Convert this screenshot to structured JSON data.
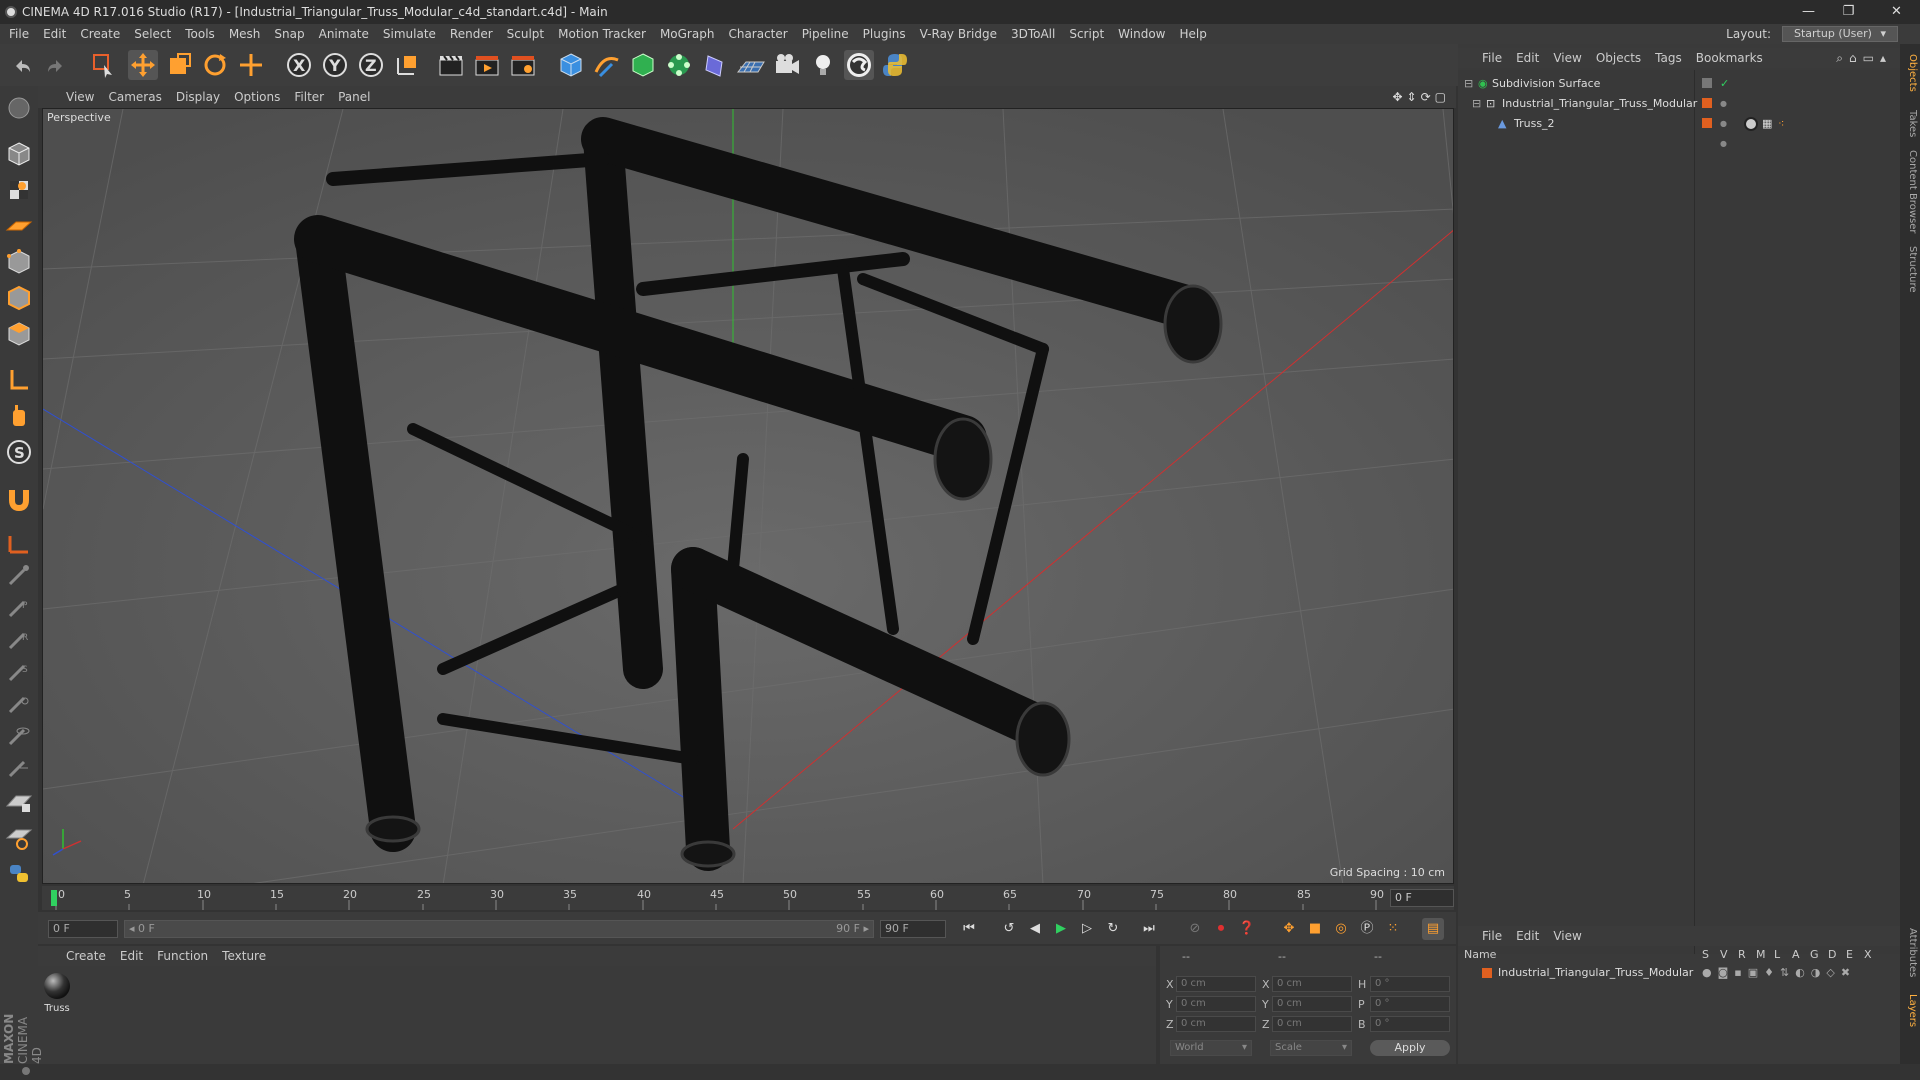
{
  "window": {
    "title": "CINEMA 4D R17.016 Studio (R17) - [Industrial_Triangular_Truss_Modular_c4d_standart.c4d] - Main",
    "minimize": "—",
    "maximize": "❐",
    "close": "✕"
  },
  "menu": [
    "File",
    "Edit",
    "Create",
    "Select",
    "Tools",
    "Mesh",
    "Snap",
    "Animate",
    "Simulate",
    "Render",
    "Sculpt",
    "Motion Tracker",
    "MoGraph",
    "Character",
    "Pipeline",
    "Plugins",
    "V-Ray Bridge",
    "3DToAll",
    "Script",
    "Window",
    "Help"
  ],
  "layout": {
    "label": "Layout:",
    "value": "Startup (User)"
  },
  "viewport": {
    "menu": [
      "View",
      "Cameras",
      "Display",
      "Options",
      "Filter",
      "Panel"
    ],
    "label": "Perspective",
    "grid_spacing": "Grid Spacing : 10 cm"
  },
  "timeline": {
    "ticks": [
      "0",
      "5",
      "10",
      "15",
      "20",
      "25",
      "30",
      "35",
      "40",
      "45",
      "50",
      "55",
      "60",
      "65",
      "70",
      "75",
      "80",
      "85",
      "90"
    ],
    "current": "0 F"
  },
  "transport": {
    "start_field": "0 F",
    "range_start": "◂ 0 F",
    "range_end": "90 F ▸",
    "end_field": "90 F"
  },
  "materials": {
    "menu": [
      "Create",
      "Edit",
      "Function",
      "Texture"
    ],
    "items": [
      {
        "name": "Truss"
      }
    ]
  },
  "attributes": {
    "header_a": "--",
    "header_b": "--",
    "header_c": "--",
    "rows": [
      {
        "a_label": "X",
        "a_val": "0 cm",
        "b_label": "X",
        "b_val": "0 cm",
        "c_label": "H",
        "c_val": "0 °"
      },
      {
        "a_label": "Y",
        "a_val": "0 cm",
        "b_label": "Y",
        "b_val": "0 cm",
        "c_label": "P",
        "c_val": "0 °"
      },
      {
        "a_label": "Z",
        "a_val": "0 cm",
        "b_label": "Z",
        "b_val": "0 cm",
        "c_label": "B",
        "c_val": "0 °"
      }
    ],
    "coord_mode": "World",
    "scale_mode": "Scale",
    "apply": "Apply"
  },
  "objects": {
    "menu": [
      "File",
      "Edit",
      "View",
      "Objects",
      "Tags",
      "Bookmarks"
    ],
    "items": [
      {
        "name": "Subdivision Surface",
        "indent": 0
      },
      {
        "name": "Industrial_Triangular_Truss_Modular",
        "indent": 1
      },
      {
        "name": "Truss_2",
        "indent": 2
      }
    ]
  },
  "layers": {
    "menu": [
      "File",
      "Edit",
      "View"
    ],
    "col_name": "Name",
    "cols": [
      "S",
      "V",
      "R",
      "M",
      "L",
      "A",
      "G",
      "D",
      "E",
      "X"
    ],
    "row": "Industrial_Triangular_Truss_Modular"
  },
  "side_tabs": [
    "Objects",
    "Takes",
    "Content Browser",
    "Structure",
    "Attributes",
    "Layers"
  ],
  "brand": {
    "maxon": "MAXON",
    "product": "CINEMA 4D"
  },
  "colors": {
    "accent": "#ffa030",
    "layer_color": "#e06020",
    "x_axis": "#d03030",
    "y_axis": "#30c030",
    "z_axis": "#3050d0"
  }
}
